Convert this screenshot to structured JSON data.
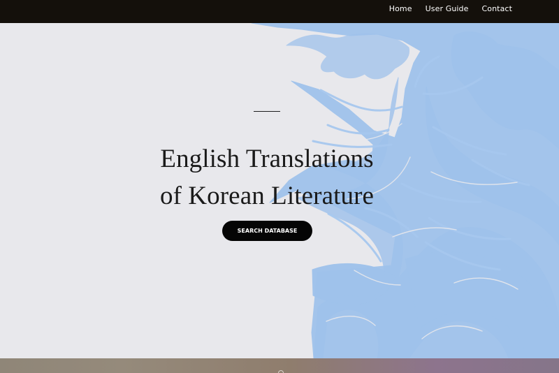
{
  "header": {
    "nav": {
      "home": "Home",
      "user_guide": "User Guide",
      "contact": "Contact"
    }
  },
  "hero": {
    "title_line_1": "English Translations",
    "title_line_2": "of Korean Literature",
    "button_label": "SEARCH DATABASE"
  },
  "colors": {
    "top_bar": "#14100b",
    "hero_background": "#e8e8ec",
    "tree_blue": "#9fc2eb",
    "button": "#050505"
  },
  "icons": {
    "tree_illustration": "tree-illustration",
    "scroll_indicator": "scroll-indicator-icon"
  }
}
